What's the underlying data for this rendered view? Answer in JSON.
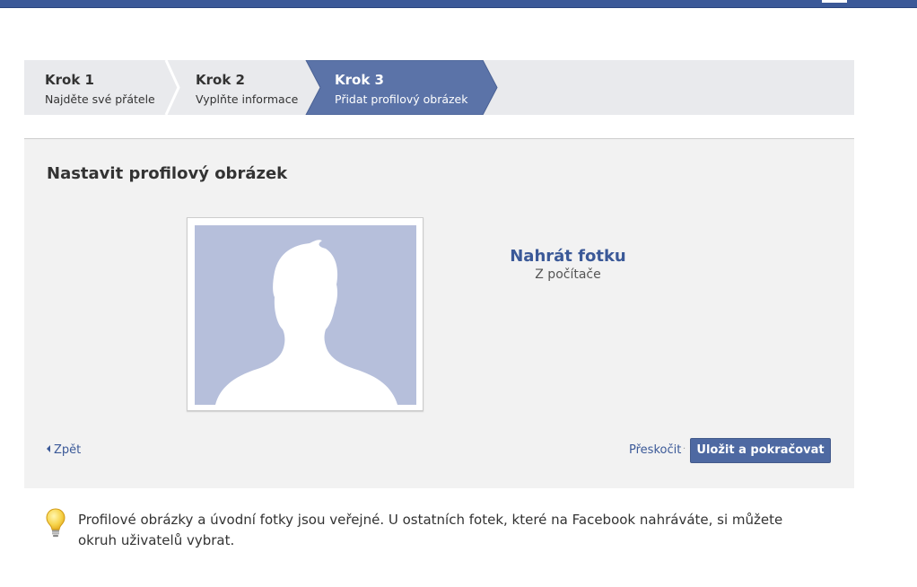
{
  "steps": [
    {
      "label": "Krok 1",
      "desc": "Najděte své přátele"
    },
    {
      "label": "Krok 2",
      "desc": "Vyplňte informace"
    },
    {
      "label": "Krok 3",
      "desc": "Přidat profilový obrázek"
    }
  ],
  "panel": {
    "title": "Nastavit profilový obrázek",
    "upload_title": "Nahrát fotku",
    "upload_sub": "Z počítače",
    "back_label": "Zpět",
    "skip_label": "Přeskočit",
    "separator": "·",
    "save_label": "Uložit a pokračovat"
  },
  "tip": {
    "icon": "lightbulb-icon",
    "text": "Profilové obrázky a úvodní fotky jsou veřejné. U ostatních fotek, které na Facebook nahráváte, si můžete okruh uživatelů vybrat."
  },
  "colors": {
    "brand": "#3b5998",
    "button": "#4e69a2",
    "active_step": "#5b73a8",
    "avatar_bg": "#b6bfdb"
  }
}
